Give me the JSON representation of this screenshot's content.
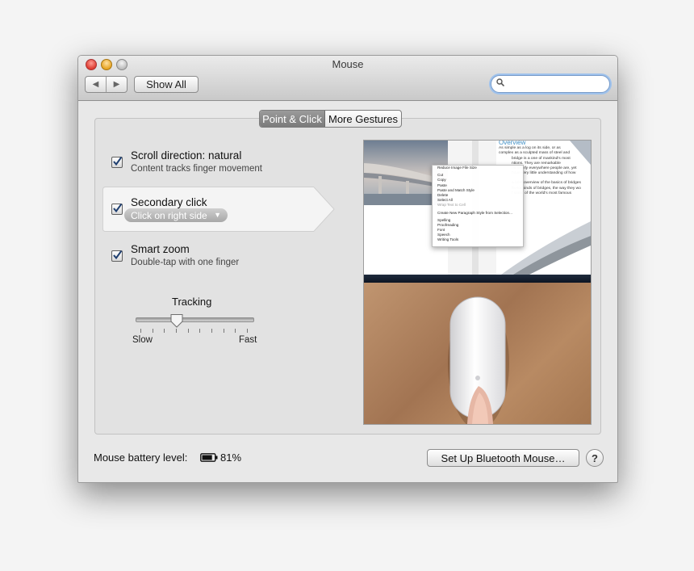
{
  "window": {
    "title": "Mouse",
    "back_icon": "◀",
    "forward_icon": "▶",
    "show_all_label": "Show All",
    "search_placeholder": ""
  },
  "tabs": [
    {
      "label": "Point & Click",
      "active": true
    },
    {
      "label": "More Gestures",
      "active": false
    }
  ],
  "options": {
    "scroll": {
      "title": "Scroll direction: natural",
      "subtitle": "Content tracks finger movement",
      "checked": true
    },
    "secondary": {
      "title": "Secondary click",
      "popup_value": "Click on right side",
      "checked": true
    },
    "zoom": {
      "title": "Smart zoom",
      "subtitle": "Double-tap with one finger",
      "checked": true
    }
  },
  "tracking": {
    "label": "Tracking",
    "min_label": "Slow",
    "max_label": "Fast",
    "value_fraction": 0.35
  },
  "preview": {
    "article_heading": "Overview",
    "article_lines": [
      "As simple as a log on its side, or as",
      "complex as a sculpted mass of steel and",
      "bridge is a one of mankind's most",
      "ntions. They are remarkable",
      "nd nearly everywhere people are, yet",
      "have very little understanding of how",
      "",
      "a brief overview of the basics of bridges",
      "ferent kinds of bridges, the way they wo",
      "f some of the world's most famous"
    ],
    "context_menu": [
      {
        "label": "Reduce Image File Size"
      },
      {
        "label": "",
        "separator": true
      },
      {
        "label": "Cut"
      },
      {
        "label": "Copy"
      },
      {
        "label": "Paste"
      },
      {
        "label": "Paste and Match Style"
      },
      {
        "label": "Delete"
      },
      {
        "label": "Select All"
      },
      {
        "label": "Wrap Text to Cell",
        "disabled": true
      },
      {
        "label": "",
        "separator": true
      },
      {
        "label": "Create New Paragraph Style from Selection..."
      },
      {
        "label": "",
        "separator": true
      },
      {
        "label": "Spelling"
      },
      {
        "label": "Proofreading"
      },
      {
        "label": "Font"
      },
      {
        "label": "Speech"
      },
      {
        "label": "Writing Tools"
      }
    ]
  },
  "footer": {
    "battery_label": "Mouse battery level:",
    "battery_percent": "81%",
    "battery_level": 0.81,
    "bluetooth_button": "Set Up Bluetooth Mouse…",
    "help_label": "?"
  },
  "colors": {
    "accent_focus": "#9fc2ec",
    "tab_active": "#8a8a8a",
    "checkmark": "#1f3f70"
  }
}
